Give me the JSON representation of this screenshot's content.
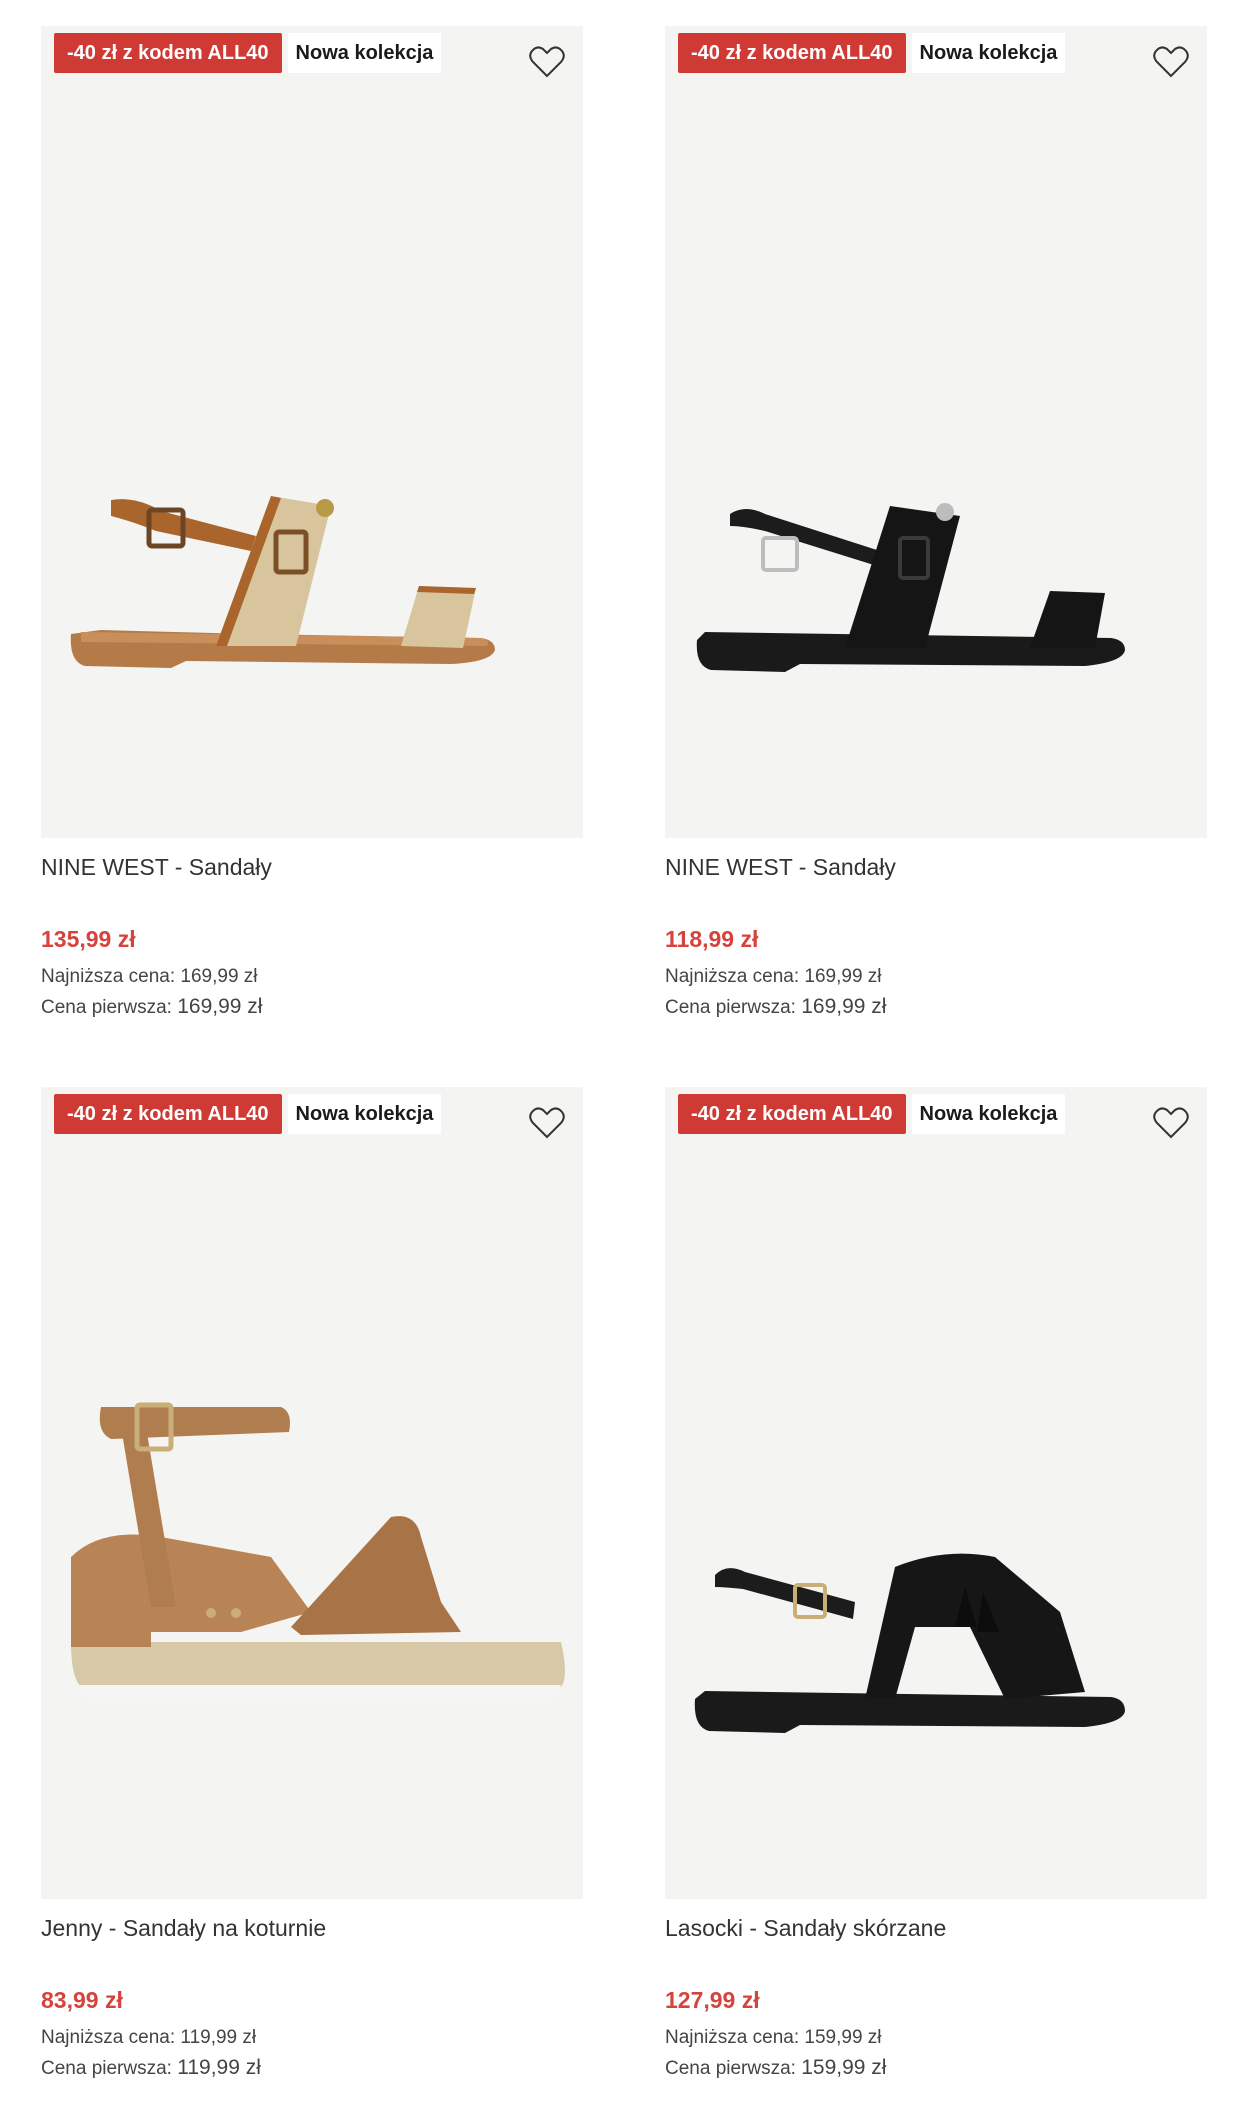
{
  "products": [
    {
      "promo_badge": "-40 zł z kodem ALL40",
      "new_badge": "Nowa kolekcja",
      "name": "NINE WEST - Sandały",
      "price": "135,99 zł",
      "lowest_label": "Najniższa cena:",
      "lowest_value": "169,99 zł",
      "original_label": "Cena pierwsza:",
      "original_value": "169,99 zł",
      "wishlist_icon": "heart-outline-icon"
    },
    {
      "promo_badge": "-40 zł z kodem ALL40",
      "new_badge": "Nowa kolekcja",
      "name": "NINE WEST - Sandały",
      "price": "118,99 zł",
      "lowest_label": "Najniższa cena:",
      "lowest_value": "169,99 zł",
      "original_label": "Cena pierwsza:",
      "original_value": "169,99 zł",
      "wishlist_icon": "heart-outline-icon"
    },
    {
      "promo_badge": "-40 zł z kodem ALL40",
      "new_badge": "Nowa kolekcja",
      "name": "Jenny - Sandały na koturnie",
      "price": "83,99 zł",
      "lowest_label": "Najniższa cena:",
      "lowest_value": "119,99 zł",
      "original_label": "Cena pierwsza:",
      "original_value": "119,99 zł",
      "wishlist_icon": "heart-outline-icon"
    },
    {
      "promo_badge": "-40 zł z kodem ALL40",
      "new_badge": "Nowa kolekcja",
      "name": "Lasocki - Sandały skórzane",
      "price": "127,99 zł",
      "lowest_label": "Najniższa cena:",
      "lowest_value": "159,99 zł",
      "original_label": "Cena pierwsza:",
      "original_value": "159,99 zł",
      "wishlist_icon": "heart-outline-icon"
    }
  ],
  "colors": {
    "promo_badge_bg": "#d03a35",
    "price_red": "#d5433c",
    "image_bg": "#f4f4f3"
  }
}
